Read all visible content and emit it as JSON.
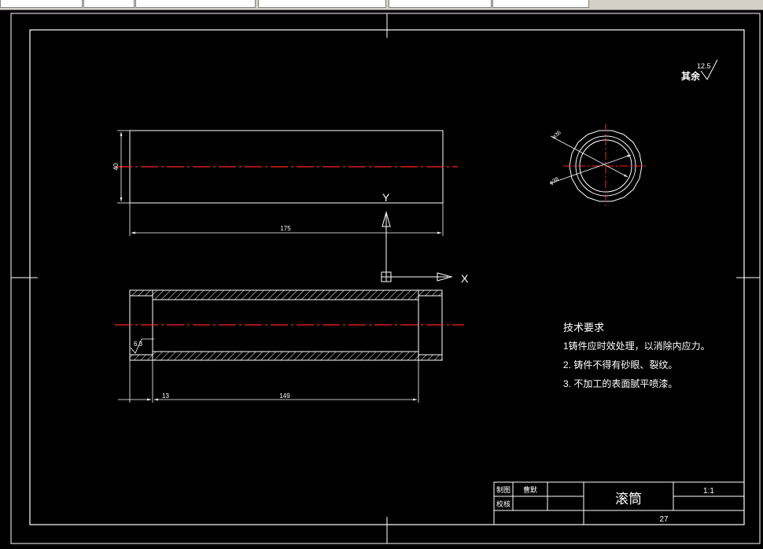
{
  "toolbar": {
    "fields": [
      "",
      "",
      "",
      "",
      ""
    ]
  },
  "colors": {
    "background": "#000000",
    "line": "#ffffff",
    "centerline": "#ff2020",
    "toolbar": "#d4d0c8"
  },
  "drawing": {
    "surface_note": {
      "label": "其余",
      "roughness": "12.5"
    },
    "dimensions": {
      "diameter": "40",
      "length": "175",
      "inner_roughness": "6.3",
      "shoulder": "13",
      "bore_length": "149",
      "dia_inner": "φ36",
      "dia_outer": "φ38"
    },
    "ucs": {
      "x": "X",
      "y": "Y"
    },
    "tech_requirements": {
      "title": "技术要求",
      "items": [
        "1铸件应时效处理，以消除内应力。",
        "2. 铸件不得有砂眼、裂纹。",
        "3. 不加工的表面腻平喷漆。"
      ]
    },
    "title_block": {
      "drawn_label": "制图",
      "drawn_by": "曹默",
      "checked_label": "校核",
      "part_name": "滚筒",
      "scale": "1:1",
      "sheet": "27"
    }
  }
}
